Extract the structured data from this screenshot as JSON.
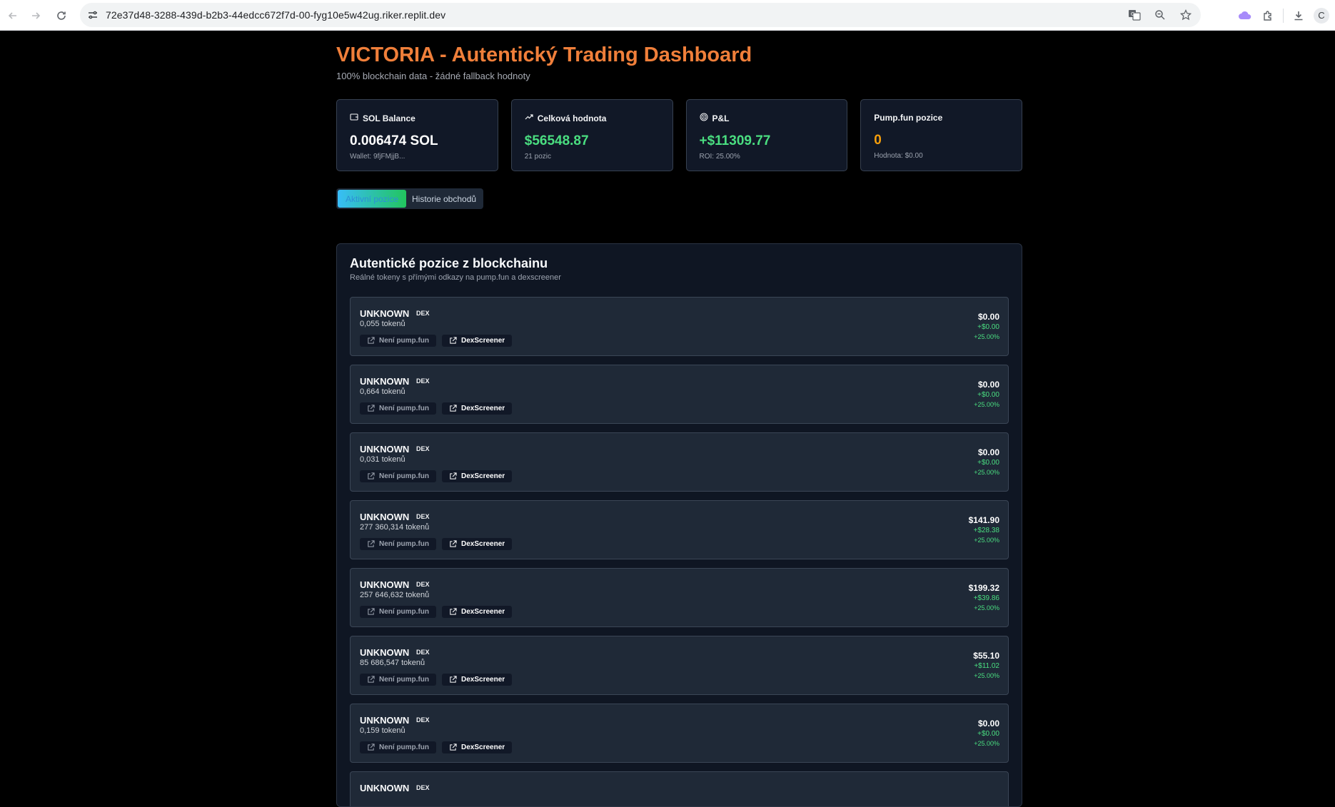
{
  "browser": {
    "url": "72e37d48-3288-439d-b2b3-44edcc672f7d-00-fyg10e5w42ug.riker.replit.dev",
    "profile_initial": "C"
  },
  "header": {
    "title": "VICTORIA - Autentický Trading Dashboard",
    "subtitle": "100% blockchain data - žádné fallback hodnoty"
  },
  "stats": [
    {
      "label": "SOL Balance",
      "icon": "wallet-icon",
      "value": "0.006474 SOL",
      "sub": "Wallet: 9fjFMjjB...",
      "color": "white"
    },
    {
      "label": "Celková hodnota",
      "icon": "trending-up-icon",
      "value": "$56548.87",
      "sub": "21 pozic",
      "color": "green"
    },
    {
      "label": "P&L",
      "icon": "target-icon",
      "value": "+$11309.77",
      "sub": "ROI: 25.00%",
      "color": "green"
    },
    {
      "label": "Pump.fun pozice",
      "icon": "",
      "value": "0",
      "sub": "Hodnota: $0.00",
      "color": "orange"
    }
  ],
  "tabs": [
    {
      "label": "Aktivní pozice",
      "active": true
    },
    {
      "label": "Historie obchodů",
      "active": false
    }
  ],
  "panel": {
    "title": "Autentické pozice z blockchainu",
    "subtitle": "Reálné tokeny s přímými odkazy na pump.fun a dexscreener"
  },
  "positions": [
    {
      "symbol": "UNKNOWN",
      "badge": "DEX",
      "amount": "0,055 tokenů",
      "btn1": "Není pump.fun",
      "btn2": "DexScreener",
      "value": "$0.00",
      "pnl": "+$0.00",
      "pct": "+25.00%"
    },
    {
      "symbol": "UNKNOWN",
      "badge": "DEX",
      "amount": "0,664 tokenů",
      "btn1": "Není pump.fun",
      "btn2": "DexScreener",
      "value": "$0.00",
      "pnl": "+$0.00",
      "pct": "+25.00%"
    },
    {
      "symbol": "UNKNOWN",
      "badge": "DEX",
      "amount": "0,031 tokenů",
      "btn1": "Není pump.fun",
      "btn2": "DexScreener",
      "value": "$0.00",
      "pnl": "+$0.00",
      "pct": "+25.00%"
    },
    {
      "symbol": "UNKNOWN",
      "badge": "DEX",
      "amount": "277 360,314 tokenů",
      "btn1": "Není pump.fun",
      "btn2": "DexScreener",
      "value": "$141.90",
      "pnl": "+$28.38",
      "pct": "+25.00%"
    },
    {
      "symbol": "UNKNOWN",
      "badge": "DEX",
      "amount": "257 646,632 tokenů",
      "btn1": "Není pump.fun",
      "btn2": "DexScreener",
      "value": "$199.32",
      "pnl": "+$39.86",
      "pct": "+25.00%"
    },
    {
      "symbol": "UNKNOWN",
      "badge": "DEX",
      "amount": "85 686,547 tokenů",
      "btn1": "Není pump.fun",
      "btn2": "DexScreener",
      "value": "$55.10",
      "pnl": "+$11.02",
      "pct": "+25.00%"
    },
    {
      "symbol": "UNKNOWN",
      "badge": "DEX",
      "amount": "0,159 tokenů",
      "btn1": "Není pump.fun",
      "btn2": "DexScreener",
      "value": "$0.00",
      "pnl": "+$0.00",
      "pct": "+25.00%"
    },
    {
      "symbol": "UNKNOWN",
      "badge": "DEX",
      "amount": "",
      "btn1": "",
      "btn2": "",
      "value": "",
      "pnl": "",
      "pct": ""
    }
  ]
}
